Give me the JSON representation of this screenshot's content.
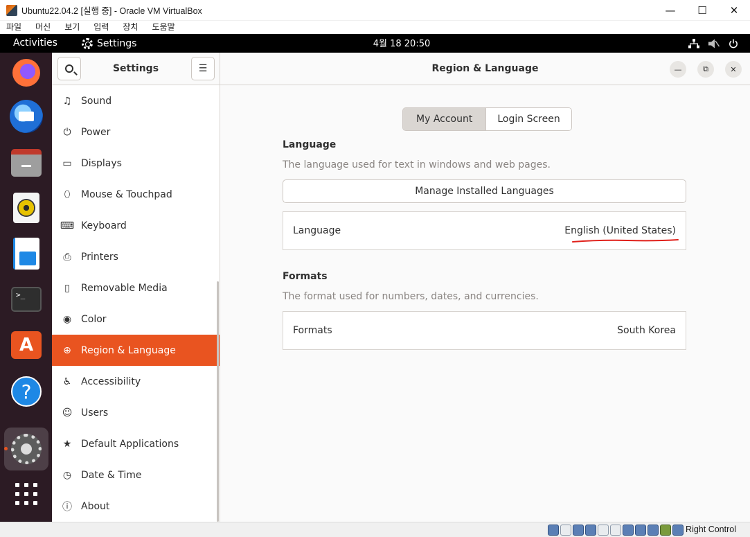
{
  "host_window": {
    "title": "Ubuntu22.04.2 [실행 중] - Oracle VM VirtualBox",
    "controls": {
      "minimize": "—",
      "maximize": "☐",
      "close": "✕"
    },
    "menus": [
      "파일",
      "머신",
      "보기",
      "입력",
      "장치",
      "도움말"
    ],
    "host_key_label": "Right Control"
  },
  "topbar": {
    "activities": "Activities",
    "app_name": "Settings",
    "clock": "4월 18  20:50"
  },
  "dock": {
    "items": [
      "firefox",
      "thunderbird",
      "files",
      "rhythmbox",
      "libreoffice-writer",
      "terminal",
      "ubuntu-software",
      "help",
      "settings",
      "show-applications"
    ],
    "terminal_prompt": ">_",
    "help_glyph": "?",
    "store_glyph": "A"
  },
  "sidebar": {
    "title": "Settings",
    "menu_glyph": "☰",
    "items": [
      {
        "label": "Sound",
        "icon": "♫"
      },
      {
        "label": "Power",
        "icon": "⏻"
      },
      {
        "label": "Displays",
        "icon": "▭"
      },
      {
        "label": "Mouse & Touchpad",
        "icon": "⬯"
      },
      {
        "label": "Keyboard",
        "icon": "⌨"
      },
      {
        "label": "Printers",
        "icon": "⎙"
      },
      {
        "label": "Removable Media",
        "icon": "▯"
      },
      {
        "label": "Color",
        "icon": "◉"
      },
      {
        "label": "Region & Language",
        "icon": "⊕"
      },
      {
        "label": "Accessibility",
        "icon": "♿"
      },
      {
        "label": "Users",
        "icon": "☺"
      },
      {
        "label": "Default Applications",
        "icon": "★"
      },
      {
        "label": "Date & Time",
        "icon": "◷"
      },
      {
        "label": "About",
        "icon": "ⓘ"
      }
    ],
    "selected_index": 8
  },
  "main": {
    "title": "Region & Language",
    "window_controls": {
      "minimize": "—",
      "restore": "⧉",
      "close": "✕"
    },
    "tabs": [
      {
        "label": "My Account",
        "active": true
      },
      {
        "label": "Login Screen",
        "active": false
      }
    ],
    "language_section": {
      "title": "Language",
      "description": "The language used for text in windows and web pages.",
      "manage_button": "Manage Installed Languages",
      "row_label": "Language",
      "row_value": "English (United States)"
    },
    "formats_section": {
      "title": "Formats",
      "description": "The format used for numbers, dates, and currencies.",
      "row_label": "Formats",
      "row_value": "South Korea"
    }
  },
  "colors": {
    "accent": "#e95420",
    "topbar": "#000000",
    "dock": "#2c1b24",
    "annotation_underline": "#e0201a"
  }
}
